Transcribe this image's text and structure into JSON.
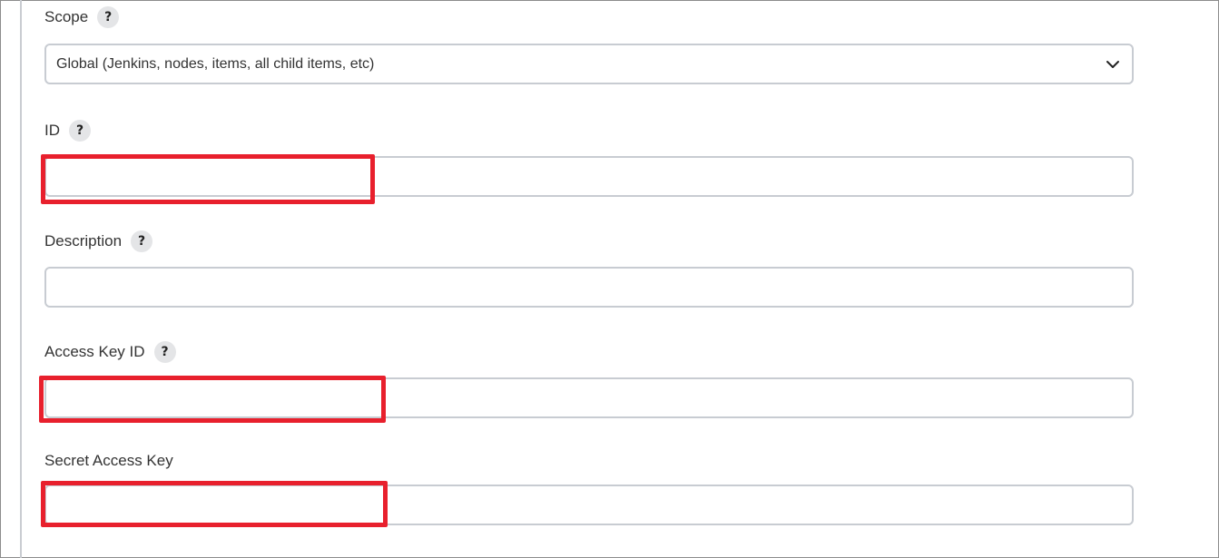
{
  "fields": {
    "scope": {
      "label": "Scope",
      "help": "?",
      "selected": "Global (Jenkins, nodes, items, all child items, etc)"
    },
    "id": {
      "label": "ID",
      "help": "?",
      "value": ""
    },
    "description": {
      "label": "Description",
      "help": "?",
      "value": ""
    },
    "access_key_id": {
      "label": "Access Key ID",
      "help": "?",
      "value": ""
    },
    "secret_access_key": {
      "label": "Secret Access Key",
      "value": ""
    }
  },
  "colors": {
    "highlight": "#e8202d",
    "input_border": "#c8ccd2",
    "help_bg": "#e4e5e7"
  },
  "icons": {
    "help": "question-mark-icon",
    "dropdown": "chevron-down-icon"
  }
}
